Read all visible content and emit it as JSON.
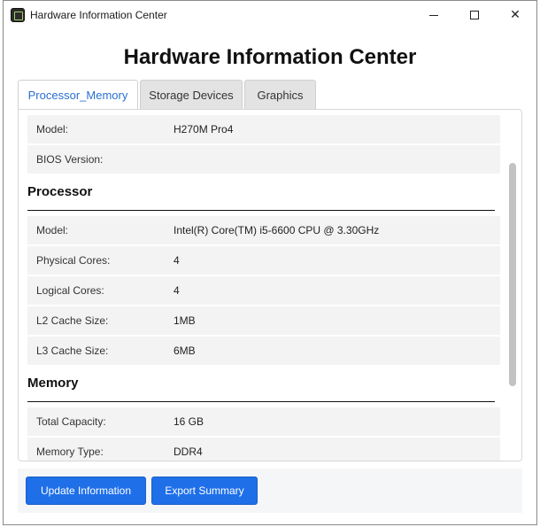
{
  "window": {
    "title": "Hardware Information Center",
    "minimize_glyph": "",
    "close_glyph": "✕"
  },
  "heading": "Hardware Information Center",
  "tabs": [
    {
      "label": "Processor_Memory",
      "active": true
    },
    {
      "label": "Storage Devices",
      "active": false
    },
    {
      "label": "Graphics",
      "active": false
    }
  ],
  "motherboard": {
    "model_label": "Model:",
    "model_value": "H270M Pro4",
    "bios_label": "BIOS Version:",
    "bios_value": ""
  },
  "processor": {
    "title": "Processor",
    "rows": [
      {
        "label": "Model:",
        "value": "Intel(R) Core(TM) i5-6600 CPU @ 3.30GHz"
      },
      {
        "label": "Physical Cores:",
        "value": "4"
      },
      {
        "label": "Logical Cores:",
        "value": "4"
      },
      {
        "label": "L2 Cache Size:",
        "value": "1MB"
      },
      {
        "label": "L3 Cache Size:",
        "value": "6MB"
      }
    ]
  },
  "memory": {
    "title": "Memory",
    "rows": [
      {
        "label": "Total Capacity:",
        "value": "16 GB"
      },
      {
        "label": "Memory Type:",
        "value": "DDR4"
      }
    ]
  },
  "footer": {
    "update_label": "Update Information",
    "export_label": "Export Summary"
  },
  "colors": {
    "accent": "#1e6fe8",
    "active_tab_text": "#2a6fd1"
  }
}
